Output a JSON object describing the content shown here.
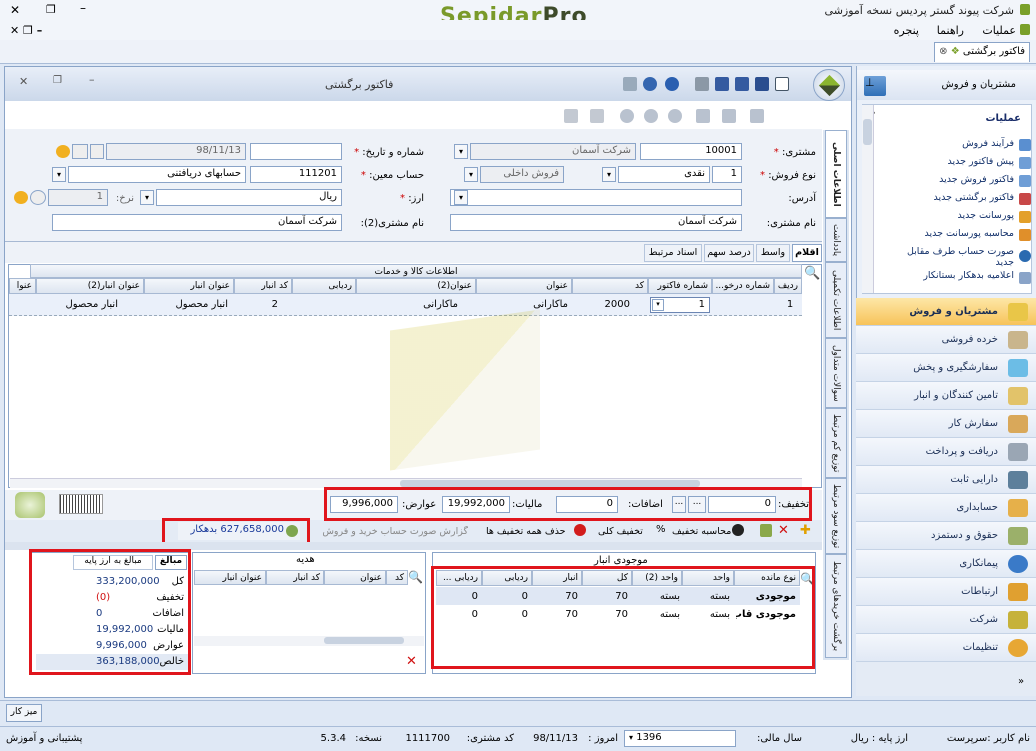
{
  "app": {
    "title": "شرکت پیوند گستر پردیس نسخه آموزشی",
    "logo_main": "Sepidar",
    "logo_suffix": "Pro",
    "colors": {
      "accent": "#f7c35a",
      "highlight": "#e0151c",
      "brand": "#7a9a2a"
    }
  },
  "menu": {
    "items": [
      "عملیات",
      "راهنما",
      "پنجره"
    ]
  },
  "doc_tab": {
    "label": "فاکتور برگشتی"
  },
  "window": {
    "title": "فاکتور برگشتی"
  },
  "vtabs": [
    "اطلاعات اصلی",
    "یادداشت",
    "اطلاعات تکمیلی",
    "سوالات متداول",
    "توزیع کم مرتبط",
    "توزیع سود مرتبط",
    "برگشت خریدهای مرتبط"
  ],
  "form": {
    "customer_label": "مشتری:",
    "customer_code": "10001",
    "customer_name": "شرکت آسمان",
    "sale_type_label": "نوع فروش:",
    "sale_type_code": "1",
    "sale_type_value": "نقدی",
    "sale_type_sub": "فروش داخلی",
    "address_label": "آدرس:",
    "customer_name_label": "نام مشتری:",
    "customer_name_value": "شرکت آسمان",
    "number_date_label": "شماره و تاریخ:",
    "date_value": "98/11/13",
    "account_label": "حساب معین:",
    "account_code": "111201",
    "account_name": "حسابهای دریافتنی",
    "currency_label": "ارز:",
    "currency_value": "ریال",
    "rate_label": "نرخ:",
    "rate_value": "1",
    "customer2_label": "نام مشتری(2):",
    "customer2_value": "شرکت آسمان"
  },
  "item_tabs": [
    "اقلام",
    "واسط",
    "درصد سهم",
    "اسناد مرتبط"
  ],
  "items_table": {
    "group_header": "اطلاعات کالا و خدمات",
    "headers": [
      "ردیف",
      "شماره درخو...",
      "شماره فاکتور",
      "کد",
      "عنوان",
      "عنوان(2)",
      "ردیابی",
      "کد انبار",
      "عنوان انبار",
      "عنوان انبار(2)",
      "عنوا"
    ],
    "rows": [
      {
        "row": "1",
        "invoice": "1",
        "code": "2000",
        "title": "ماکارانی",
        "title2": "ماکارانی",
        "warehouse_code": "2",
        "warehouse": "انبار محصول",
        "warehouse2": "انبار محصول"
      }
    ]
  },
  "totals_bar": {
    "discount_label": "تخفیف:",
    "discount": "0",
    "additions_label": "اضافات:",
    "additions": "0",
    "tax_label": "مالیات:",
    "tax": "19,992,000",
    "duties_label": "عوارض:",
    "duties": "9,996,000"
  },
  "actions": [
    "محاسبه تخفیف",
    "تخفیف کلی",
    "حذف همه تخفیف ها",
    "گزارش صورت حساب خرید و فروش"
  ],
  "balance": {
    "value": "627,658,000",
    "suffix": "بدهکار"
  },
  "summary": {
    "tabs": [
      "مبالغ",
      "مبالغ به ارز پایه"
    ],
    "rows": [
      {
        "k": "کل",
        "v": "333,200,000"
      },
      {
        "k": "تخفیف",
        "v": "(0)"
      },
      {
        "k": "اضافات",
        "v": "0"
      },
      {
        "k": "مالیات",
        "v": "19,992,000"
      },
      {
        "k": "عوارض",
        "v": "9,996,000"
      },
      {
        "k": "خالص",
        "v": "363,188,000"
      }
    ]
  },
  "gift": {
    "title": "هدیه",
    "headers": [
      "کد",
      "عنوان",
      "کد انبار",
      "عنوان انبار"
    ]
  },
  "stock": {
    "title": "موجودی انبار",
    "headers": [
      "نوع مانده",
      "واحد",
      "واحد (2)",
      "کل",
      "انبار",
      "ردیابی",
      "ردیابی ..."
    ],
    "rows": [
      {
        "type": "موجودی",
        "unit": "بسته",
        "unit2": "بسته",
        "total": "70",
        "wh": "70",
        "track": "0",
        "track2": "0"
      },
      {
        "type": "موجودی قاب...",
        "unit": "بسته",
        "unit2": "بسته",
        "total": "70",
        "wh": "70",
        "track": "0",
        "track2": "0"
      }
    ]
  },
  "sidebar": {
    "header": "مشتریان و فروش",
    "ops_title": "عملیات",
    "ops": [
      "فرآیند فروش",
      "پیش فاکتور جدید",
      "فاکتور فروش جدید",
      "فاکتور برگشتی جدید",
      "پورسانت جدید",
      "محاسبه پورسانت جدید",
      "صورت حساب طرف مقابل جدید",
      "اعلامیه بدهکار بستانکار"
    ],
    "nav": [
      "مشتریان و فروش",
      "خرده فروشی",
      "سفارشگیری و پخش",
      "تامین کنندگان و انبار",
      "سفارش کار",
      "دریافت و پرداخت",
      "دارایی ثابت",
      "حسابداری",
      "حقوق و دستمزد",
      "پیمانکاری",
      "ارتباطات",
      "شرکت",
      "تنظیمات"
    ]
  },
  "taskbar": {
    "desk": "میز کار"
  },
  "status": {
    "user": "نام کاربر :سرپرست",
    "base_currency": "ارز پایه : ریال",
    "fiscal_year_label": "سال مالی:",
    "fiscal_year": "1396",
    "today_label": "امروز :",
    "today": "98/11/13",
    "customer_code_label": "کد مشتری:",
    "customer_code": "1111700",
    "version_label": "نسخه:",
    "version": "5.3.4",
    "support": "پشتیبانی و آموزش"
  }
}
